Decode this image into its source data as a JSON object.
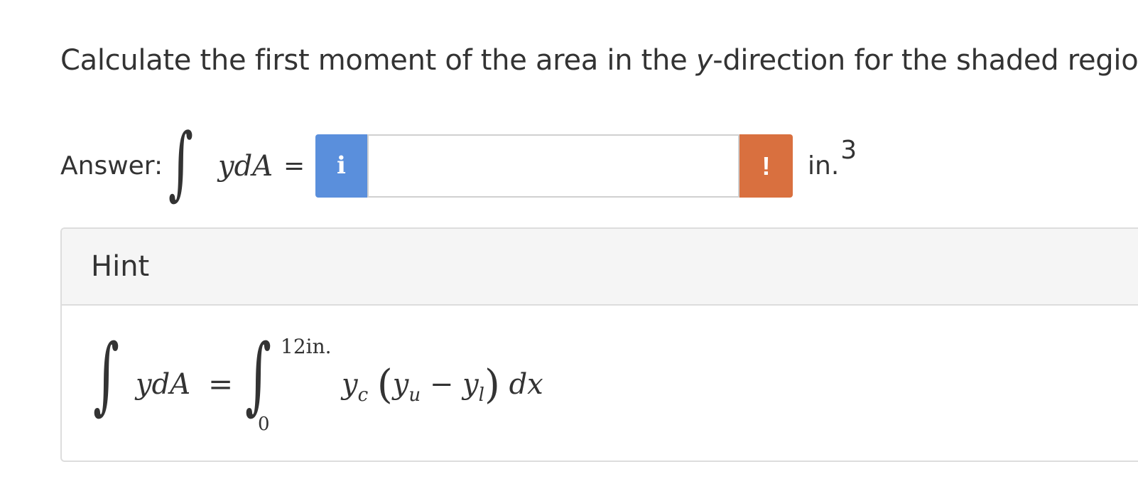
{
  "question": {
    "text_before": "Calculate the first moment of the area in the ",
    "variable": "y",
    "text_after": "-direction for the shaded region."
  },
  "answer": {
    "label": "Answer:",
    "integral_symbol": "∫",
    "expression": "ydA",
    "equals": "=",
    "info_button_glyph": "i",
    "input_value": "",
    "input_placeholder": "",
    "warning_button_glyph": "!",
    "unit": "in.",
    "unit_exponent": "3",
    "info_color": "#5a8fdc",
    "warning_color": "#d9703f"
  },
  "hint": {
    "title": "Hint",
    "integral_symbol": "∫",
    "lhs": "ydA",
    "equals": "=",
    "upper_limit": "12in.",
    "lower_limit": "0",
    "integrand": {
      "y_c": "y",
      "c_sub": "c",
      "open_paren": "(",
      "y_u": "y",
      "u_sub": "u",
      "minus": " − ",
      "y_l": "y",
      "l_sub": "l",
      "close_paren": ")",
      "dx": "dx"
    }
  }
}
